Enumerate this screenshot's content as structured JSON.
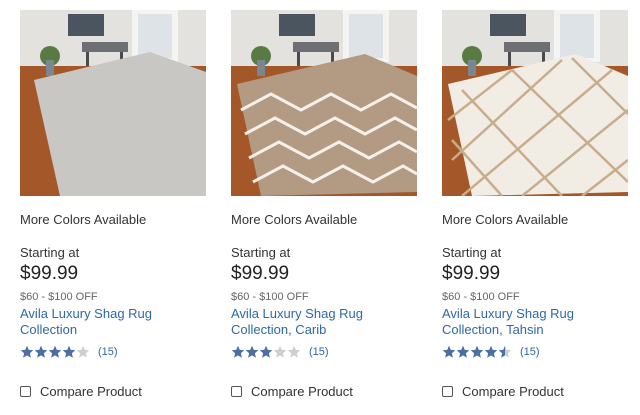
{
  "products": [
    {
      "more_colors": "More Colors Available",
      "starting_label": "Starting at",
      "price": "$99.99",
      "savings": "$60 - $100 OFF",
      "title": "Avila Luxury Shag Rug Collection",
      "rating": 4,
      "review_count": "(15)",
      "compare_label": "Compare Product",
      "rug_color": "#c9c7c3",
      "rug_pattern": "solid"
    },
    {
      "more_colors": "More Colors Available",
      "starting_label": "Starting at",
      "price": "$99.99",
      "savings": "$60 - $100 OFF",
      "title": "Avila Luxury Shag Rug Collection, Carib",
      "rating": 3,
      "review_count": "(15)",
      "compare_label": "Compare Product",
      "rug_color": "#b39a82",
      "rug_pattern": "geometric-white"
    },
    {
      "more_colors": "More Colors Available",
      "starting_label": "Starting at",
      "price": "$99.99",
      "savings": "$60 - $100 OFF",
      "title": "Avila Luxury Shag Rug Collection, Tahsin",
      "rating": 4.5,
      "review_count": "(15)",
      "compare_label": "Compare Product",
      "rug_color": "#f2ede4",
      "rug_pattern": "diamond-tan"
    }
  ],
  "colors": {
    "link": "#2d68a8",
    "star_filled": "#4a6fa5",
    "star_empty": "#cfcfcf",
    "floor": "#a1592c",
    "wall": "#e8e6e2"
  }
}
